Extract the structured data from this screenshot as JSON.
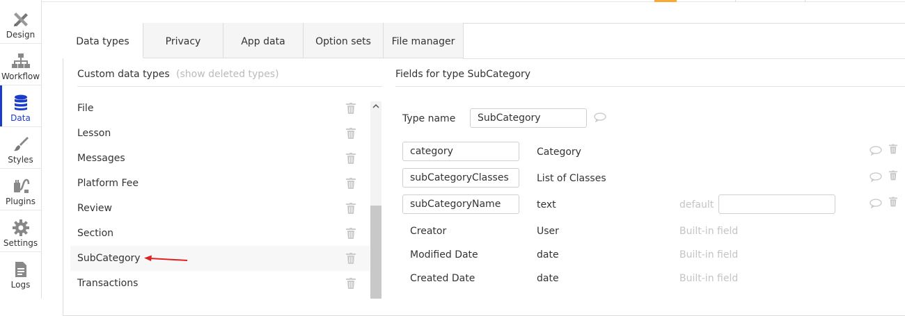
{
  "nav": [
    {
      "label": "Design",
      "icon": "design-tools-icon",
      "active": false
    },
    {
      "label": "Workflow",
      "icon": "workflow-icon",
      "active": false
    },
    {
      "label": "Data",
      "icon": "database-icon",
      "active": true
    },
    {
      "label": "Styles",
      "icon": "brush-icon",
      "active": false
    },
    {
      "label": "Plugins",
      "icon": "plug-icon",
      "active": false
    },
    {
      "label": "Settings",
      "icon": "gear-icon",
      "active": false
    },
    {
      "label": "Logs",
      "icon": "document-icon",
      "active": false
    }
  ],
  "tabs": [
    "Data types",
    "Privacy",
    "App data",
    "Option sets",
    "File manager"
  ],
  "custom_types": {
    "title": "Custom data types",
    "show_deleted": "(show deleted types)",
    "items": [
      "File",
      "Lesson",
      "Messages",
      "Platform Fee",
      "Review",
      "Section",
      "SubCategory",
      "Transactions"
    ]
  },
  "fields_panel": {
    "title": "Fields for type SubCategory",
    "type_name_label": "Type name",
    "type_name_value": "SubCategory",
    "fields": [
      {
        "name": "category",
        "type": "Category"
      },
      {
        "name": "subCategoryClasses",
        "type": "List of Classes"
      },
      {
        "name": "subCategoryName",
        "type": "text",
        "default_label": "default",
        "default_value": ""
      }
    ],
    "builtin": [
      {
        "name": "Creator",
        "type": "User",
        "note": "Built-in field"
      },
      {
        "name": "Modified Date",
        "type": "date",
        "note": "Built-in field"
      },
      {
        "name": "Created Date",
        "type": "date",
        "note": "Built-in field"
      }
    ]
  },
  "colors": {
    "active_blue": "#1a3cc8",
    "accent_orange": "#f7a935",
    "arrow_red": "#e02020"
  }
}
